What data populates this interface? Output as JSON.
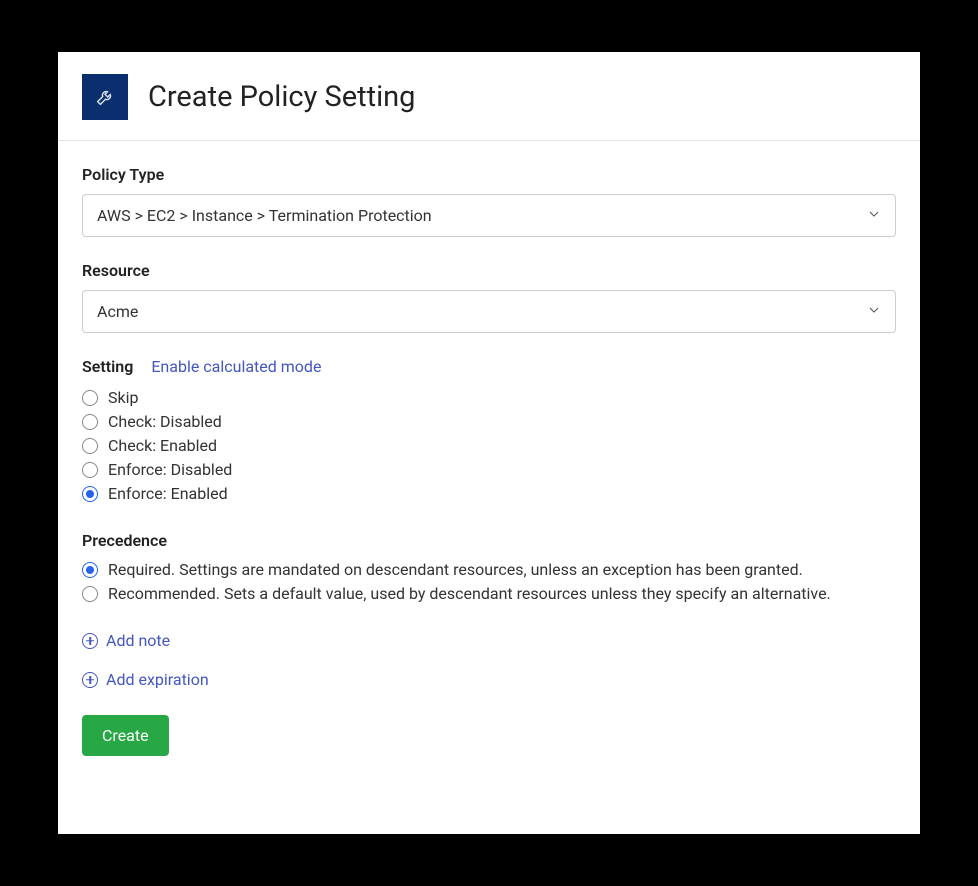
{
  "header": {
    "title": "Create Policy Setting"
  },
  "policyType": {
    "label": "Policy Type",
    "value": "AWS > EC2 > Instance > Termination Protection"
  },
  "resource": {
    "label": "Resource",
    "value": "Acme"
  },
  "setting": {
    "label": "Setting",
    "calculatedModeLink": "Enable calculated mode",
    "options": [
      {
        "label": "Skip",
        "checked": false
      },
      {
        "label": "Check: Disabled",
        "checked": false
      },
      {
        "label": "Check: Enabled",
        "checked": false
      },
      {
        "label": "Enforce: Disabled",
        "checked": false
      },
      {
        "label": "Enforce: Enabled",
        "checked": true
      }
    ]
  },
  "precedence": {
    "label": "Precedence",
    "options": [
      {
        "label": "Required. Settings are mandated on descendant resources, unless an exception has been granted.",
        "checked": true
      },
      {
        "label": "Recommended. Sets a default value, used by descendant resources unless they specify an alternative.",
        "checked": false
      }
    ]
  },
  "addLinks": {
    "note": "Add note",
    "expiration": "Add expiration"
  },
  "createButton": "Create"
}
